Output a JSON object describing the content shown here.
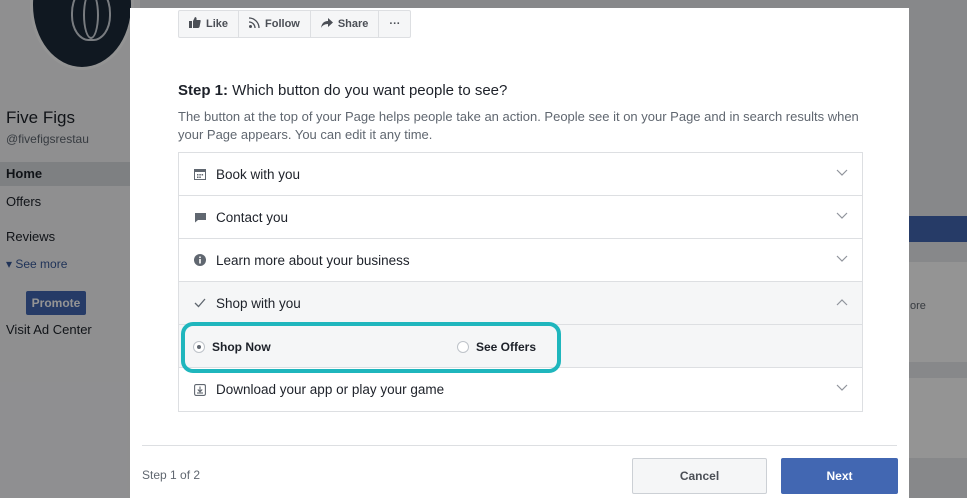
{
  "background": {
    "page_name": "Five Figs",
    "page_handle": "@fivefigsrestau",
    "nav": [
      "Home",
      "Offers",
      "Reviews"
    ],
    "see_more": "See more",
    "promote": "Promote",
    "ad_center": "Visit Ad Center",
    "right_fragment": "ore"
  },
  "toolbar": {
    "like": "Like",
    "follow": "Follow",
    "share": "Share",
    "more": "···"
  },
  "step": {
    "prefix": "Step 1:",
    "question": " Which button do you want people to see?",
    "description": "The button at the top of your Page helps people take an action. People see it on your Page and in search results when your Page appears. You can edit it any time."
  },
  "options": [
    {
      "label": "Book with you",
      "icon": "calendar-icon"
    },
    {
      "label": "Contact you",
      "icon": "message-icon"
    },
    {
      "label": "Learn more about your business",
      "icon": "info-icon"
    },
    {
      "label": "Shop with you",
      "icon": "check-icon",
      "expanded": true
    },
    {
      "label": "Download your app or play your game",
      "icon": "download-icon"
    }
  ],
  "shop_choices": {
    "selected": "Shop Now",
    "other": "See Offers"
  },
  "footer": {
    "step_count": "Step 1 of 2",
    "cancel": "Cancel",
    "next": "Next"
  },
  "colors": {
    "primary": "#4267b2",
    "highlight": "#1fb6bd"
  }
}
